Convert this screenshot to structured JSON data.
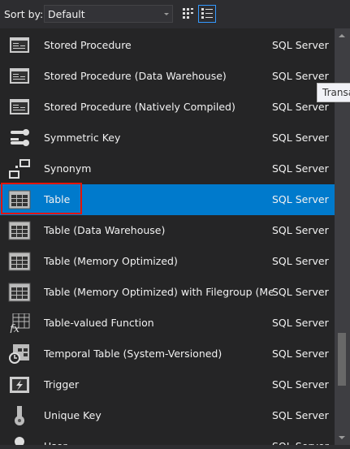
{
  "toolbar": {
    "sort_label": "Sort by:",
    "sort_value": "Default",
    "view_small_icons": "small-icons-view",
    "view_list": "list-view"
  },
  "items": [
    {
      "name": "Stored Procedure",
      "source": "SQL Server",
      "icon": "stored-procedure"
    },
    {
      "name": "Stored Procedure (Data Warehouse)",
      "source": "SQL Server",
      "icon": "stored-procedure"
    },
    {
      "name": "Stored Procedure (Natively Compiled)",
      "source": "SQL Server",
      "icon": "stored-procedure"
    },
    {
      "name": "Symmetric Key",
      "source": "SQL Server",
      "icon": "key"
    },
    {
      "name": "Synonym",
      "source": "SQL Server",
      "icon": "synonym"
    },
    {
      "name": "Table",
      "source": "SQL Server",
      "icon": "table",
      "selected": true
    },
    {
      "name": "Table (Data Warehouse)",
      "source": "SQL Server",
      "icon": "table"
    },
    {
      "name": "Table (Memory Optimized)",
      "source": "SQL Server",
      "icon": "table"
    },
    {
      "name": "Table (Memory Optimized) with Filegroup (Me...",
      "source": "SQL Server",
      "icon": "table"
    },
    {
      "name": "Table-valued Function",
      "source": "SQL Server",
      "icon": "function"
    },
    {
      "name": "Temporal Table (System-Versioned)",
      "source": "SQL Server",
      "icon": "temporal-table"
    },
    {
      "name": "Trigger",
      "source": "SQL Server",
      "icon": "trigger"
    },
    {
      "name": "Unique Key",
      "source": "SQL Server",
      "icon": "unique-key"
    },
    {
      "name": "User",
      "source": "SQL Server",
      "icon": "user"
    }
  ],
  "tooltip": "Transa",
  "colors": {
    "selection": "#007acc",
    "highlight_box": "#e51400"
  }
}
